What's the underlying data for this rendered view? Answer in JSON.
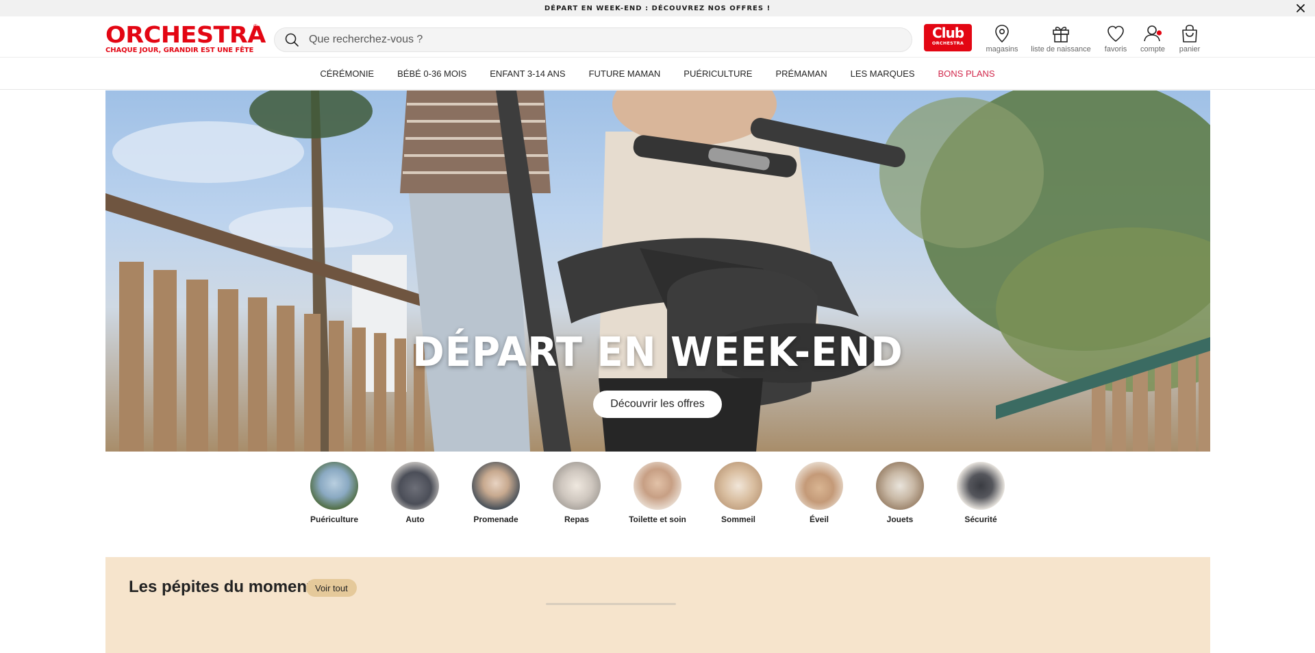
{
  "announcement": {
    "text": "DÉPART EN WEEK-END : DÉCOUVREZ NOS OFFRES !"
  },
  "logo": {
    "name": "ORCHESTRA",
    "registered": "®",
    "tagline": "CHAQUE JOUR, GRANDIR EST UNE FÊTE"
  },
  "search": {
    "placeholder": "Que recherchez-vous ?"
  },
  "club": {
    "line1": "Club",
    "line2": "ORCHESTRA"
  },
  "header_icons": [
    {
      "icon": "map-pin-icon",
      "label": "magasins"
    },
    {
      "icon": "gift-icon",
      "label": "liste de naissance"
    },
    {
      "icon": "heart-icon",
      "label": "favoris"
    },
    {
      "icon": "user-icon",
      "label": "compte"
    },
    {
      "icon": "bag-icon",
      "label": "panier"
    }
  ],
  "nav": {
    "items": [
      {
        "label": "CÉRÉMONIE"
      },
      {
        "label": "BÉBÉ 0-36 MOIS"
      },
      {
        "label": "ENFANT 3-14 ANS"
      },
      {
        "label": "FUTURE MAMAN"
      },
      {
        "label": "PUÉRICULTURE"
      },
      {
        "label": "PRÉMAMAN"
      },
      {
        "label": "LES MARQUES"
      },
      {
        "label": "BONS PLANS"
      }
    ],
    "promo_color": "#d1274b"
  },
  "hero": {
    "title": "DÉPART EN WEEK-END",
    "cta": "Découvrir les offres"
  },
  "categories": [
    {
      "label": "Puériculture"
    },
    {
      "label": "Auto"
    },
    {
      "label": "Promenade"
    },
    {
      "label": "Repas"
    },
    {
      "label": "Toilette et soin"
    },
    {
      "label": "Sommeil"
    },
    {
      "label": "Éveil"
    },
    {
      "label": "Jouets"
    },
    {
      "label": "Sécurité"
    }
  ],
  "pepites": {
    "title": "Les pépites du moment",
    "link": "Voir tout"
  },
  "colors": {
    "brand": "#e30613",
    "section_bg": "#f6e4cc",
    "pill_bg": "#e5c99a"
  }
}
